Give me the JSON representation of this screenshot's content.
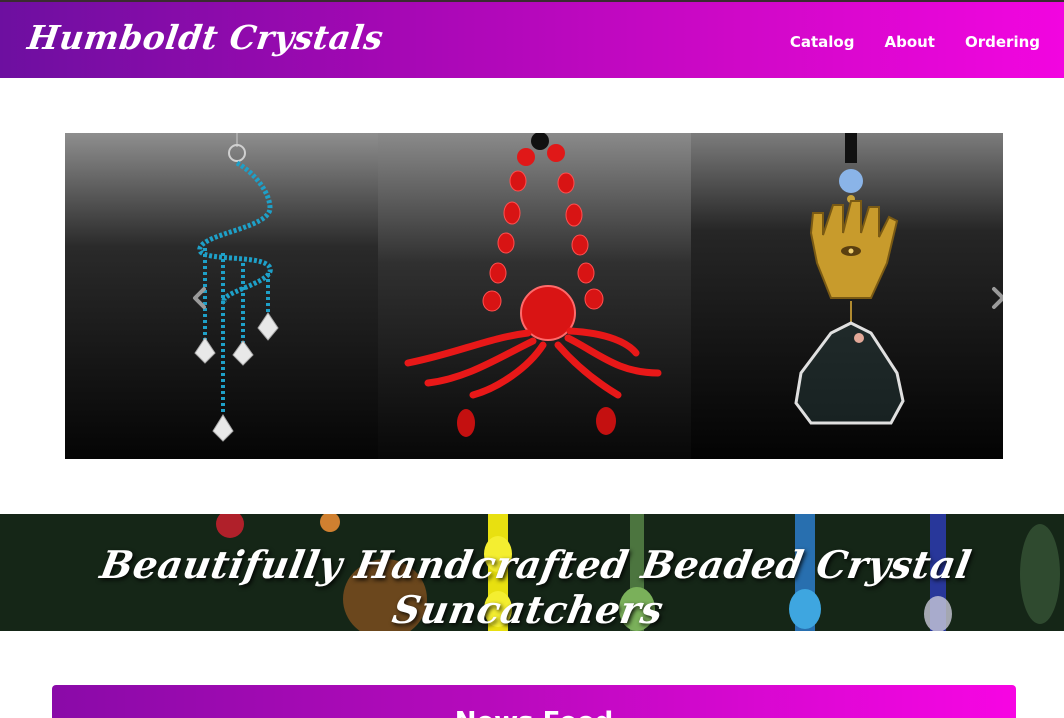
{
  "brand": {
    "name": "Humboldt Crystals"
  },
  "nav": {
    "items": [
      {
        "label": "Catalog"
      },
      {
        "label": "About"
      },
      {
        "label": "Ordering"
      }
    ]
  },
  "carousel": {
    "slides": [
      {
        "icon": "spiral-suncatcher-image"
      },
      {
        "icon": "red-octopus-suncatcher-image"
      },
      {
        "icon": "hamsa-suncatcher-image"
      }
    ],
    "prev_icon": "chevron-left-icon",
    "next_icon": "chevron-right-icon"
  },
  "hero": {
    "title": "Beautifully Handcrafted Beaded Crystal Suncatchers"
  },
  "news": {
    "title": "News Feed"
  },
  "colors": {
    "nav_gradient_start": "#6d0fa0",
    "nav_gradient_end": "#f205e0",
    "text": "#ffffff"
  }
}
